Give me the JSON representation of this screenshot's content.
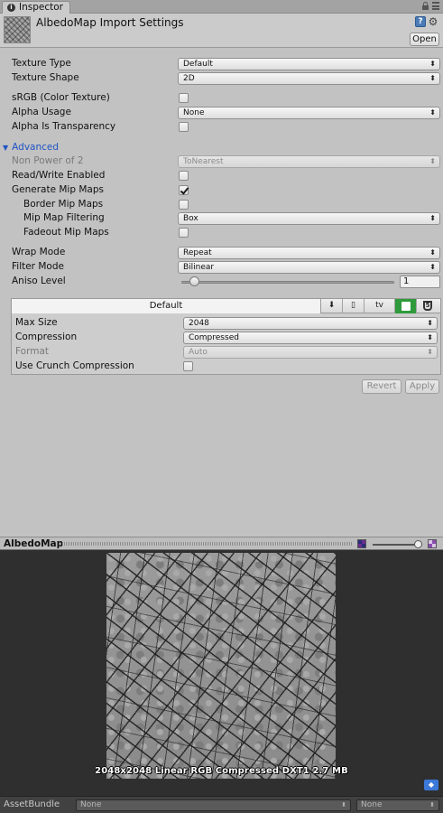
{
  "tab": {
    "title": "Inspector"
  },
  "header": {
    "title": "AlbedoMap Import Settings",
    "open_label": "Open"
  },
  "settings": {
    "texture_type": {
      "label": "Texture Type",
      "value": "Default"
    },
    "texture_shape": {
      "label": "Texture Shape",
      "value": "2D"
    },
    "srgb": {
      "label": "sRGB (Color Texture)",
      "checked": false
    },
    "alpha_usage": {
      "label": "Alpha Usage",
      "value": "None"
    },
    "alpha_is_transparency": {
      "label": "Alpha Is Transparency",
      "checked": false
    },
    "advanced": {
      "label": "Advanced",
      "expanded": true
    },
    "non_power_of_2": {
      "label": "Non Power of 2",
      "value": "ToNearest",
      "disabled": true
    },
    "read_write": {
      "label": "Read/Write Enabled",
      "checked": false
    },
    "generate_mip_maps": {
      "label": "Generate Mip Maps",
      "checked": true
    },
    "border_mip_maps": {
      "label": "Border Mip Maps",
      "checked": false
    },
    "mip_map_filtering": {
      "label": "Mip Map Filtering",
      "value": "Box"
    },
    "fadeout_mip_maps": {
      "label": "Fadeout Mip Maps",
      "checked": false
    },
    "wrap_mode": {
      "label": "Wrap Mode",
      "value": "Repeat"
    },
    "filter_mode": {
      "label": "Filter Mode",
      "value": "Bilinear"
    },
    "aniso_level": {
      "label": "Aniso Level",
      "value": "1"
    }
  },
  "platform": {
    "default_tab": "Default",
    "tabs": [
      {
        "name": "standalone-tab",
        "icon": "download-icon"
      },
      {
        "name": "ios-tab",
        "icon": "phone-icon"
      },
      {
        "name": "tvos-tab",
        "icon": "appletv-icon",
        "text": "tv"
      },
      {
        "name": "android-tab",
        "icon": "android-icon"
      },
      {
        "name": "webgl-tab",
        "icon": "html5-icon",
        "text": "5"
      }
    ],
    "max_size": {
      "label": "Max Size",
      "value": "2048"
    },
    "compression": {
      "label": "Compression",
      "value": "Compressed"
    },
    "format": {
      "label": "Format",
      "value": "Auto",
      "disabled": true
    },
    "crunch": {
      "label": "Use Crunch Compression",
      "checked": false
    }
  },
  "actions": {
    "revert": "Revert",
    "apply": "Apply"
  },
  "preview": {
    "title": "AlbedoMap",
    "info": "2048x2048  Linear  RGB Compressed DXT1  2.7 MB"
  },
  "asset_bundle": {
    "label": "AssetBundle",
    "name_value": "None",
    "variant_value": "None"
  },
  "colors": {
    "foldout": "#1f53c6",
    "android": "#2e9a3b",
    "panel_bg": "#c2c2c2",
    "preview_bg": "#2f2f2f"
  }
}
